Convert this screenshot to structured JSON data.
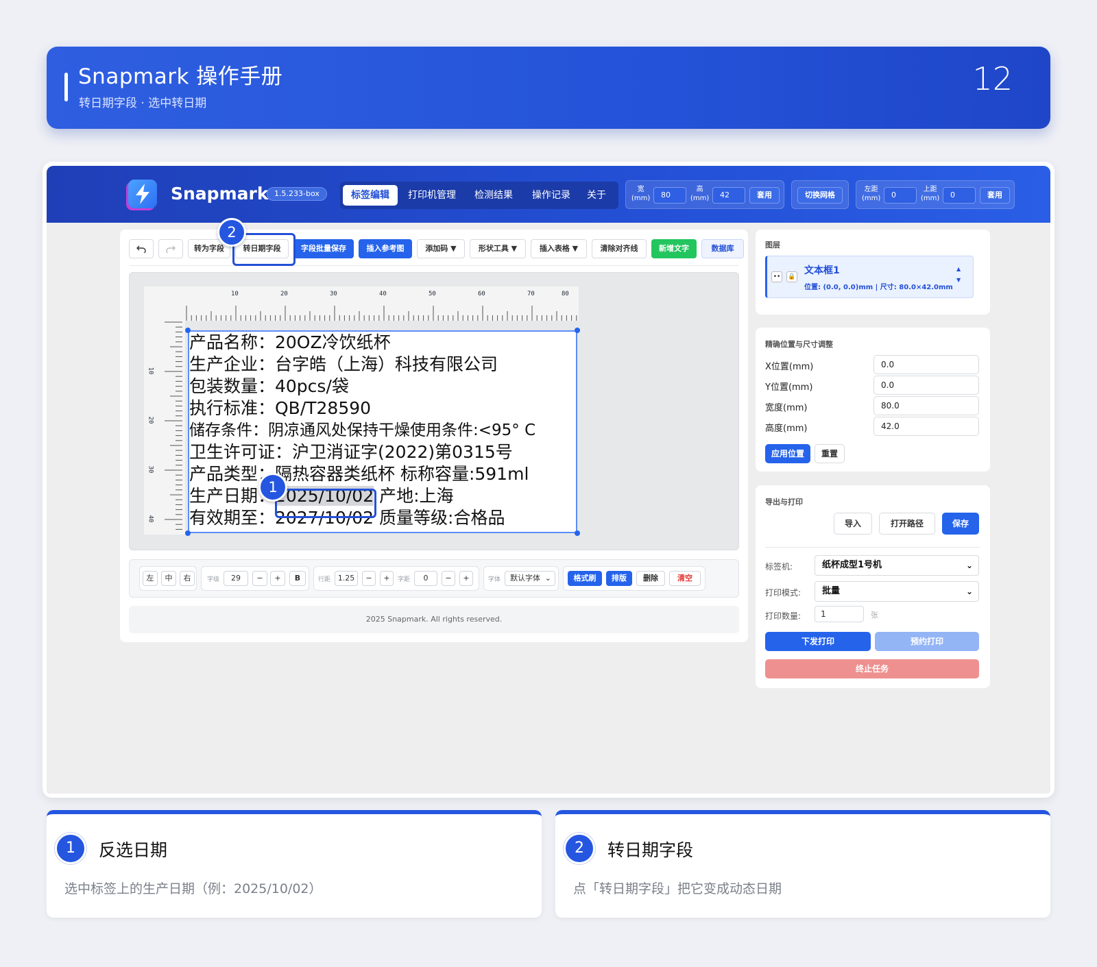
{
  "banner": {
    "title": "Snapmark 操作手册",
    "subtitle": "转日期字段 · 选中转日期",
    "page_number": "12"
  },
  "colors": {
    "primary": "#2456e0",
    "accent_green": "#22c55e",
    "danger": "#ee9090"
  },
  "app": {
    "brand": "Snapmark",
    "version": "1.5.233-box",
    "nav": [
      "标签编辑",
      "打印机管理",
      "检测结果",
      "操作记录",
      "关于"
    ],
    "size": {
      "width_label": "宽",
      "height_label": "高",
      "unit": "(mm)",
      "width": "80",
      "height": "42",
      "apply": "套用"
    },
    "grid_toggle": "切换网格",
    "margin": {
      "left_label": "左距",
      "top_label": "上距",
      "unit": "(mm)",
      "left": "0",
      "top": "0",
      "apply": "套用"
    }
  },
  "toolbar": {
    "undo_icon": "undo-icon",
    "redo_icon": "redo-icon",
    "to_field": "转为字段",
    "to_date_field": "转日期字段",
    "batch_save": "字段批量保存",
    "insert_ref": "插入参考图",
    "add_code": "添加码 ▼",
    "shape_tool": "形状工具 ▼",
    "insert_table": "插入表格 ▼",
    "clear_guides": "清除对齐线",
    "add_text": "新增文字",
    "database": "数据库"
  },
  "ruler": {
    "top": [
      "10",
      "20",
      "30",
      "40",
      "50",
      "60",
      "70",
      "80"
    ],
    "left": [
      "10",
      "20",
      "30",
      "40"
    ]
  },
  "label_lines": [
    "产品名称：20OZ冷饮纸杯",
    "生产企业：台字皓（上海）科技有限公司",
    "包装数量：40pcs/袋",
    "执行标准：QB/T28590",
    "储存条件：阴凉通风处保持干燥使用条件:<95° C",
    "卫生许可证：沪卫消证字(2022)第0315号",
    "产品类型：隔热容器类纸杯  标称容量:591ml",
    "生产日期：",
    "有效期至：2027/10/02  质量等级:合格品"
  ],
  "label_selected_date": "2025/10/02",
  "label_origin": "产地:上海",
  "format": {
    "align": [
      "左",
      "中",
      "右"
    ],
    "font_size_label": "字级",
    "font_size": "29",
    "minus": "−",
    "plus": "+",
    "bold": "B",
    "line_height_label": "行距",
    "line_height": "1.25",
    "letter_spacing_label": "字距",
    "letter_spacing": "0",
    "font_label": "字体",
    "font_value": "默认字体",
    "format_brush": "格式刷",
    "layout": "排版",
    "delete": "删除",
    "clear": "清空"
  },
  "footer": "2025 Snapmark. All rights reserved.",
  "layers": {
    "title": "图层",
    "item_name": "文本框1",
    "item_info": "位置: (0.0, 0.0)mm | 尺寸: 80.0×42.0mm"
  },
  "position": {
    "title": "精确位置与尺寸调整",
    "fields": [
      {
        "label": "X位置(mm)",
        "value": "0.0"
      },
      {
        "label": "Y位置(mm)",
        "value": "0.0"
      },
      {
        "label": "宽度(mm)",
        "value": "80.0"
      },
      {
        "label": "高度(mm)",
        "value": "42.0"
      }
    ],
    "apply": "应用位置",
    "reset": "重置"
  },
  "export": {
    "title": "导出与打印",
    "import": "导入",
    "open_path": "打开路径",
    "save": "保存",
    "printer_label": "标签机:",
    "printer": "纸杯成型1号机",
    "mode_label": "打印模式:",
    "mode": "批量",
    "count_label": "打印数量:",
    "count": "1",
    "count_unit": "张",
    "print": "下发打印",
    "schedule": "预约打印",
    "stop": "终止任务"
  },
  "callouts": {
    "one": "1",
    "two": "2"
  },
  "steps": [
    {
      "num": "1",
      "title": "反选日期",
      "desc": "选中标签上的生产日期（例：2025/10/02）"
    },
    {
      "num": "2",
      "title": "转日期字段",
      "desc": "点「转日期字段」把它变成动态日期"
    }
  ]
}
